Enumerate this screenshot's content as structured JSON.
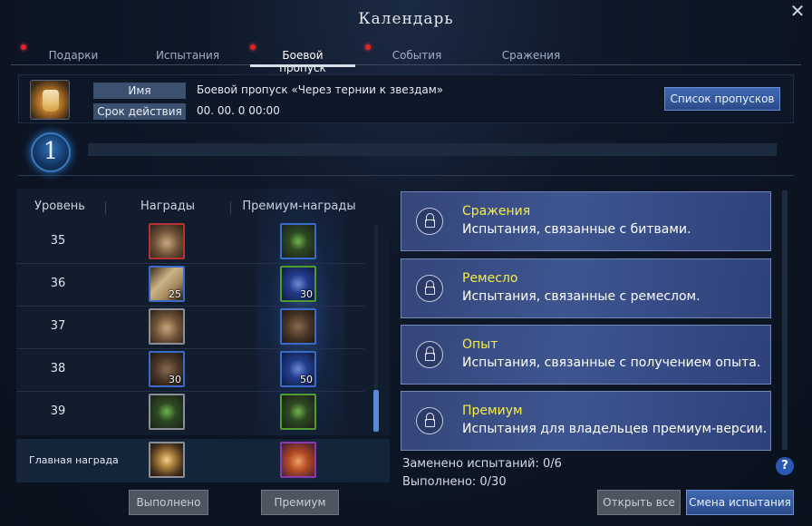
{
  "window": {
    "title": "Календарь"
  },
  "tabs": [
    {
      "label": "Подарки",
      "active": false,
      "notify": true
    },
    {
      "label": "Испытания",
      "active": false,
      "notify": false
    },
    {
      "label": "Боевой пропуск",
      "active": true,
      "notify": true
    },
    {
      "label": "События",
      "active": false,
      "notify": true
    },
    {
      "label": "Сражения",
      "active": false,
      "notify": false
    }
  ],
  "pass_info": {
    "name_label": "Имя",
    "name_value": "Боевой пропуск «Через тернии к звездам»",
    "duration_label": "Срок действия",
    "duration_value": "00. 00. 0 00:00",
    "list_button": "Список пропусков"
  },
  "level": {
    "current": "1",
    "progress": 0
  },
  "rewards_table": {
    "headers": {
      "level": "Уровень",
      "rewards": "Награды",
      "premium": "Премиум-награды"
    },
    "rows": [
      {
        "level": "35",
        "reward": {
          "icon": "chest",
          "border": "red",
          "qty": ""
        },
        "premium": {
          "icon": "green-orb",
          "border": "blue",
          "qty": ""
        }
      },
      {
        "level": "36",
        "reward": {
          "icon": "scroll",
          "border": "blue",
          "qty": "25"
        },
        "premium": {
          "icon": "blue-gem",
          "border": "green",
          "qty": "30"
        }
      },
      {
        "level": "37",
        "reward": {
          "icon": "chest",
          "border": "gray",
          "qty": ""
        },
        "premium": {
          "icon": "box",
          "border": "blue",
          "qty": ""
        }
      },
      {
        "level": "38",
        "reward": {
          "icon": "box",
          "border": "blue",
          "qty": "30"
        },
        "premium": {
          "icon": "blue-gem",
          "border": "blue",
          "qty": "50"
        }
      },
      {
        "level": "39",
        "reward": {
          "icon": "green-orb",
          "border": "gray",
          "qty": ""
        },
        "premium": {
          "icon": "green-orb",
          "border": "green",
          "qty": ""
        }
      }
    ],
    "main_reward_label": "Главная награда"
  },
  "bottom_left_buttons": {
    "completed": "Выполнено",
    "premium": "Премиум"
  },
  "challenges": [
    {
      "title": "Сражения",
      "desc": "Испытания, связанные с битвами."
    },
    {
      "title": "Ремесло",
      "desc": "Испытания, связанные с ремеслом."
    },
    {
      "title": "Опыт",
      "desc": "Испытания, связанные с получением опыта."
    },
    {
      "title": "Премиум",
      "desc": "Испытания для владельцев премиум-версии."
    }
  ],
  "stats": {
    "replaced": "Заменено испытаний: 0/6",
    "completed": "Выполнено: 0/30"
  },
  "bottom_right_buttons": {
    "open_all": "Открыть все",
    "change": "Смена испытания"
  },
  "help": "?",
  "colors": {
    "accent_yellow": "#f4ee4a",
    "notify_red": "#e0232b",
    "button_blue": "#3f69b1"
  }
}
